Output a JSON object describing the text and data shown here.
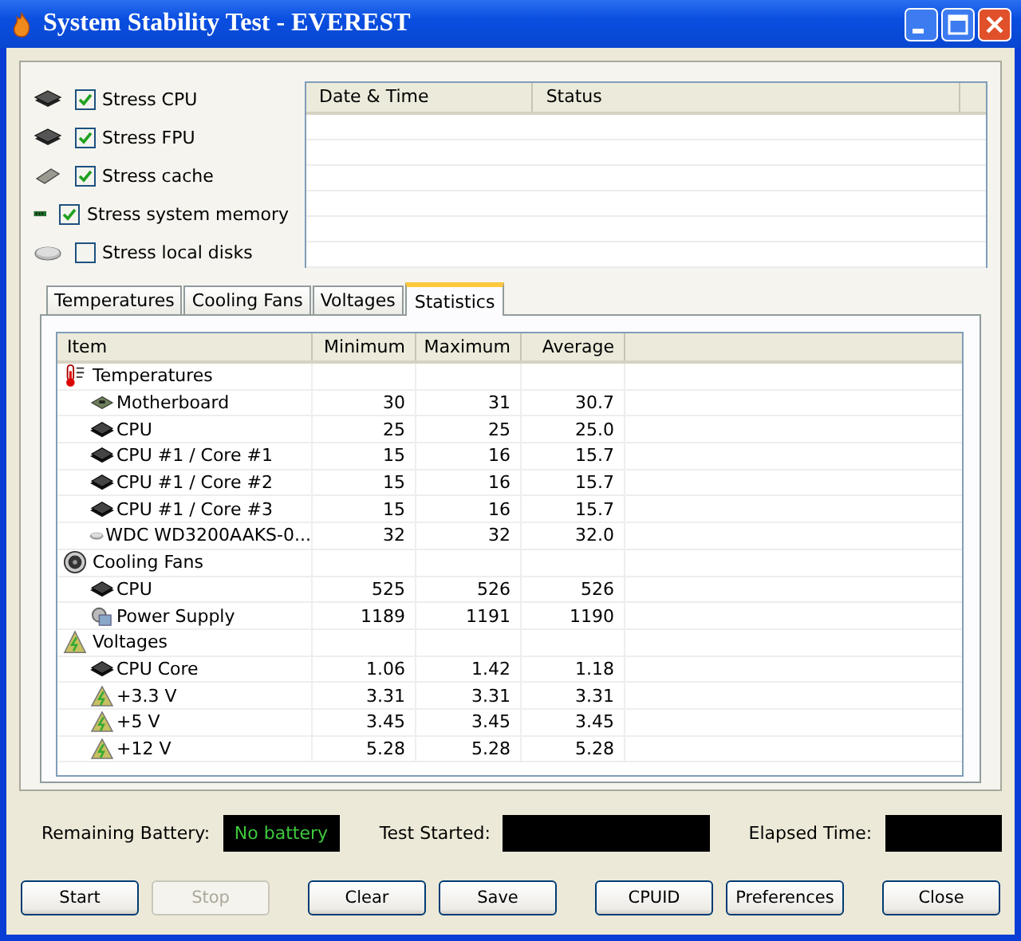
{
  "window": {
    "title": "System Stability Test - EVEREST"
  },
  "stress_options": [
    {
      "label": "Stress CPU",
      "kind": "cpu",
      "checked": true
    },
    {
      "label": "Stress FPU",
      "kind": "fpu",
      "checked": true
    },
    {
      "label": "Stress cache",
      "kind": "cache",
      "checked": true
    },
    {
      "label": "Stress system memory",
      "kind": "memory",
      "checked": true
    },
    {
      "label": "Stress local disks",
      "kind": "disk",
      "checked": false
    }
  ],
  "log_table": {
    "columns": [
      "Date & Time",
      "Status"
    ]
  },
  "tabs": [
    {
      "label": "Temperatures",
      "selected": false
    },
    {
      "label": "Cooling Fans",
      "selected": false
    },
    {
      "label": "Voltages",
      "selected": false
    },
    {
      "label": "Statistics",
      "selected": true
    }
  ],
  "statistics": {
    "columns": [
      "Item",
      "Minimum",
      "Maximum",
      "Average"
    ],
    "groups": [
      {
        "label": "Temperatures",
        "kind": "thermometer",
        "children": [
          {
            "label": "Motherboard",
            "kind": "board",
            "minimum": "30",
            "maximum": "31",
            "average": "30.7"
          },
          {
            "label": "CPU",
            "kind": "cpu",
            "minimum": "25",
            "maximum": "25",
            "average": "25.0"
          },
          {
            "label": "CPU #1 / Core #1",
            "kind": "cpu",
            "minimum": "15",
            "maximum": "16",
            "average": "15.7"
          },
          {
            "label": "CPU #1 / Core #2",
            "kind": "cpu",
            "minimum": "15",
            "maximum": "16",
            "average": "15.7"
          },
          {
            "label": "CPU #1 / Core #3",
            "kind": "cpu",
            "minimum": "15",
            "maximum": "16",
            "average": "15.7"
          },
          {
            "label": "WDC WD3200AAKS-0...",
            "kind": "disk",
            "minimum": "32",
            "maximum": "32",
            "average": "32.0"
          }
        ]
      },
      {
        "label": "Cooling Fans",
        "kind": "fan",
        "children": [
          {
            "label": "CPU",
            "kind": "cpu",
            "minimum": "525",
            "maximum": "526",
            "average": "526"
          },
          {
            "label": "Power Supply",
            "kind": "psu",
            "minimum": "1189",
            "maximum": "1191",
            "average": "1190"
          }
        ]
      },
      {
        "label": "Voltages",
        "kind": "voltage",
        "children": [
          {
            "label": "CPU Core",
            "kind": "cpu",
            "minimum": "1.06",
            "maximum": "1.42",
            "average": "1.18"
          },
          {
            "label": "+3.3 V",
            "kind": "voltage",
            "minimum": "3.31",
            "maximum": "3.31",
            "average": "3.31"
          },
          {
            "label": "+5 V",
            "kind": "voltage",
            "minimum": "3.45",
            "maximum": "3.45",
            "average": "3.45"
          },
          {
            "label": "+12 V",
            "kind": "voltage",
            "minimum": "5.28",
            "maximum": "5.28",
            "average": "5.28"
          }
        ]
      }
    ]
  },
  "status": {
    "battery_label": "Remaining Battery:",
    "battery_value": "No battery",
    "test_started_label": "Test Started:",
    "elapsed_time_label": "Elapsed Time:"
  },
  "buttons": [
    {
      "label": "Start",
      "disabled": false
    },
    {
      "label": "Stop",
      "disabled": true
    },
    {
      "label": "Clear",
      "disabled": false
    },
    {
      "label": "Save",
      "disabled": false
    },
    {
      "label": "CPUID",
      "disabled": false
    },
    {
      "label": "Preferences",
      "disabled": false
    },
    {
      "label": "Close",
      "disabled": false
    }
  ]
}
